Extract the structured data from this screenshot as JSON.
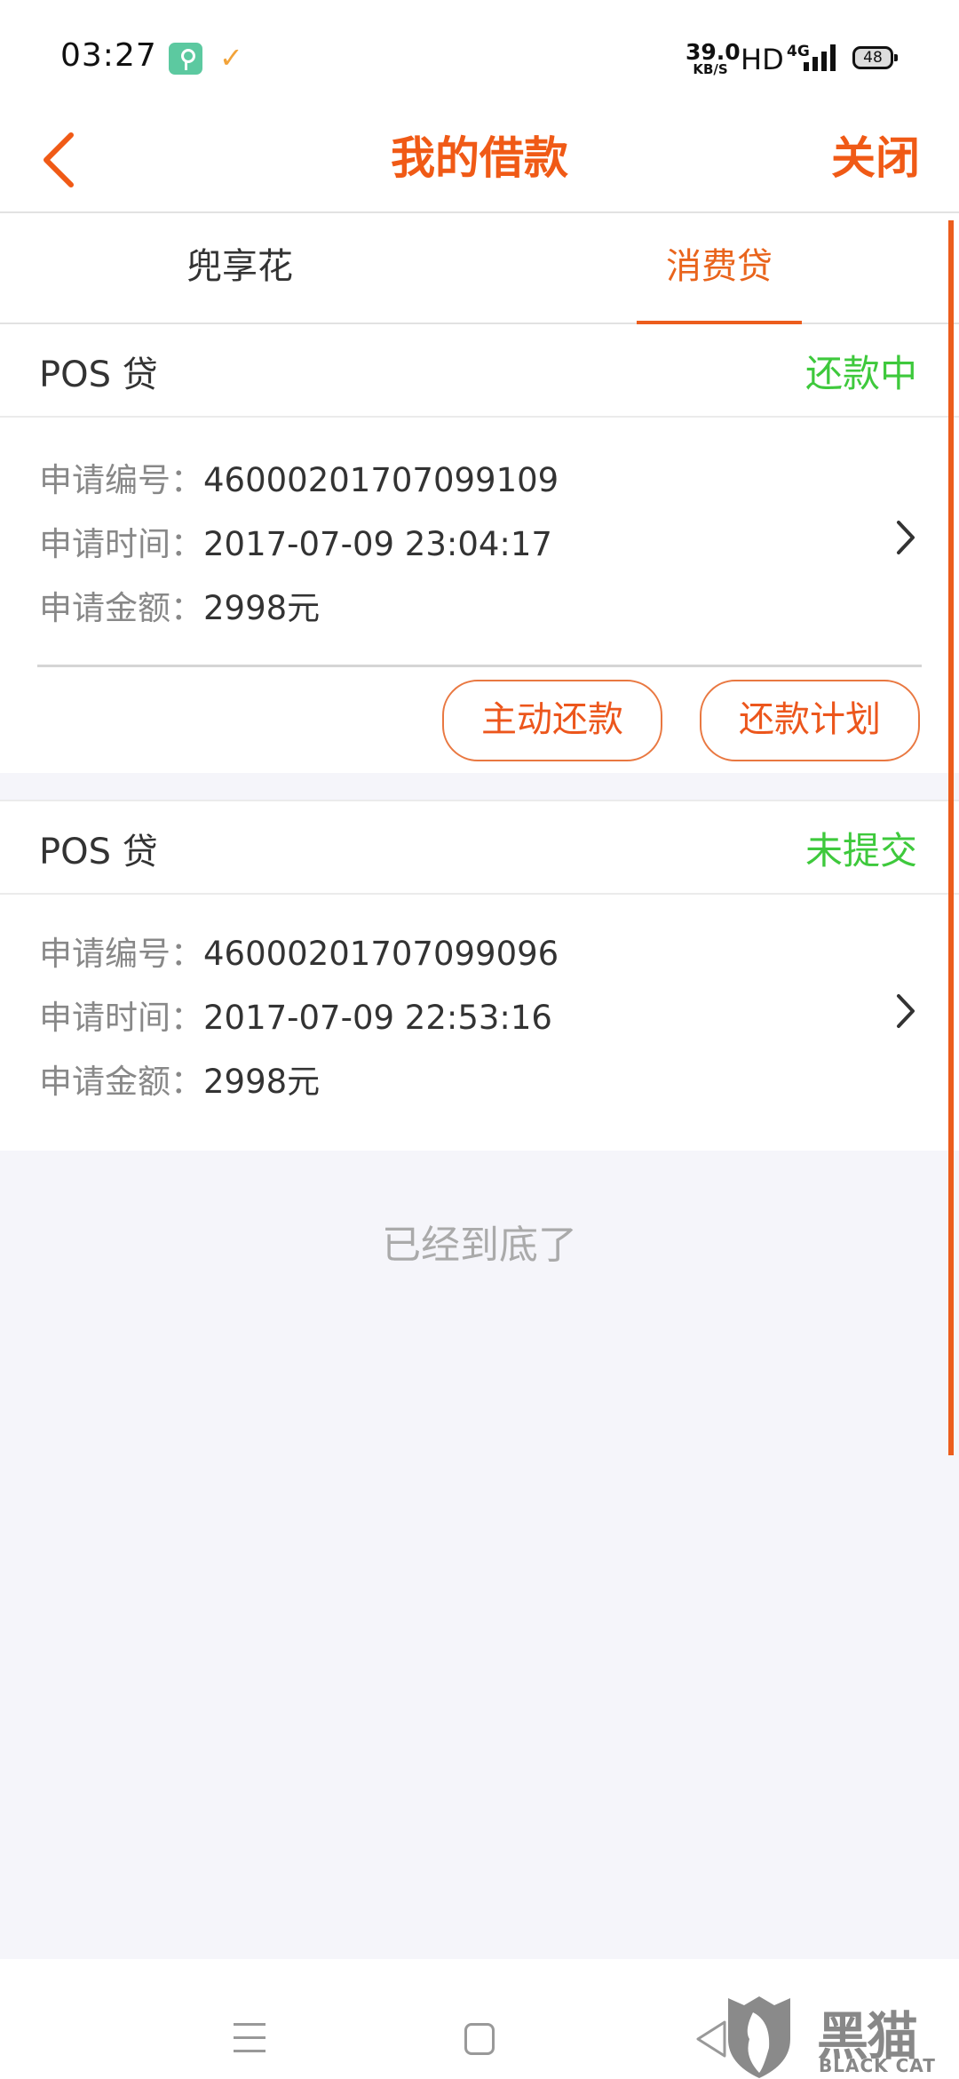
{
  "status_bar": {
    "time": "03:27",
    "net_speed_value": "39.0",
    "net_speed_unit": "KB/S",
    "hd": "HD",
    "network": "4G",
    "battery": "48"
  },
  "header": {
    "title": "我的借款",
    "close_label": "关闭",
    "accent_color": "#f05a16"
  },
  "tabs": [
    {
      "label": "兜享花",
      "active": false
    },
    {
      "label": "消费贷",
      "active": true
    }
  ],
  "loans": [
    {
      "type": "POS 贷",
      "status": "还款中",
      "fields": [
        {
          "label": "申请编号",
          "sep": "：",
          "value": "46000201707099109"
        },
        {
          "label": "申请时间",
          "sep": "：",
          "value": "2017-07-09 23:04:17"
        },
        {
          "label": "申请金额",
          "sep": "：",
          "value": "2998元"
        }
      ],
      "actions": [
        {
          "label": "主动还款"
        },
        {
          "label": "还款计划"
        }
      ]
    },
    {
      "type": "POS 贷",
      "status": "未提交",
      "fields": [
        {
          "label": "申请编号",
          "sep": "：",
          "value": "46000201707099096"
        },
        {
          "label": "申请时间",
          "sep": "：",
          "value": "2017-07-09 22:53:16"
        },
        {
          "label": "申请金额",
          "sep": "：",
          "value": "2998元"
        }
      ]
    }
  ],
  "list_end_text": "已经到底了",
  "status_color": "#3ec93c",
  "watermark": {
    "cn": "黑猫",
    "en": "BLACK CAT"
  }
}
